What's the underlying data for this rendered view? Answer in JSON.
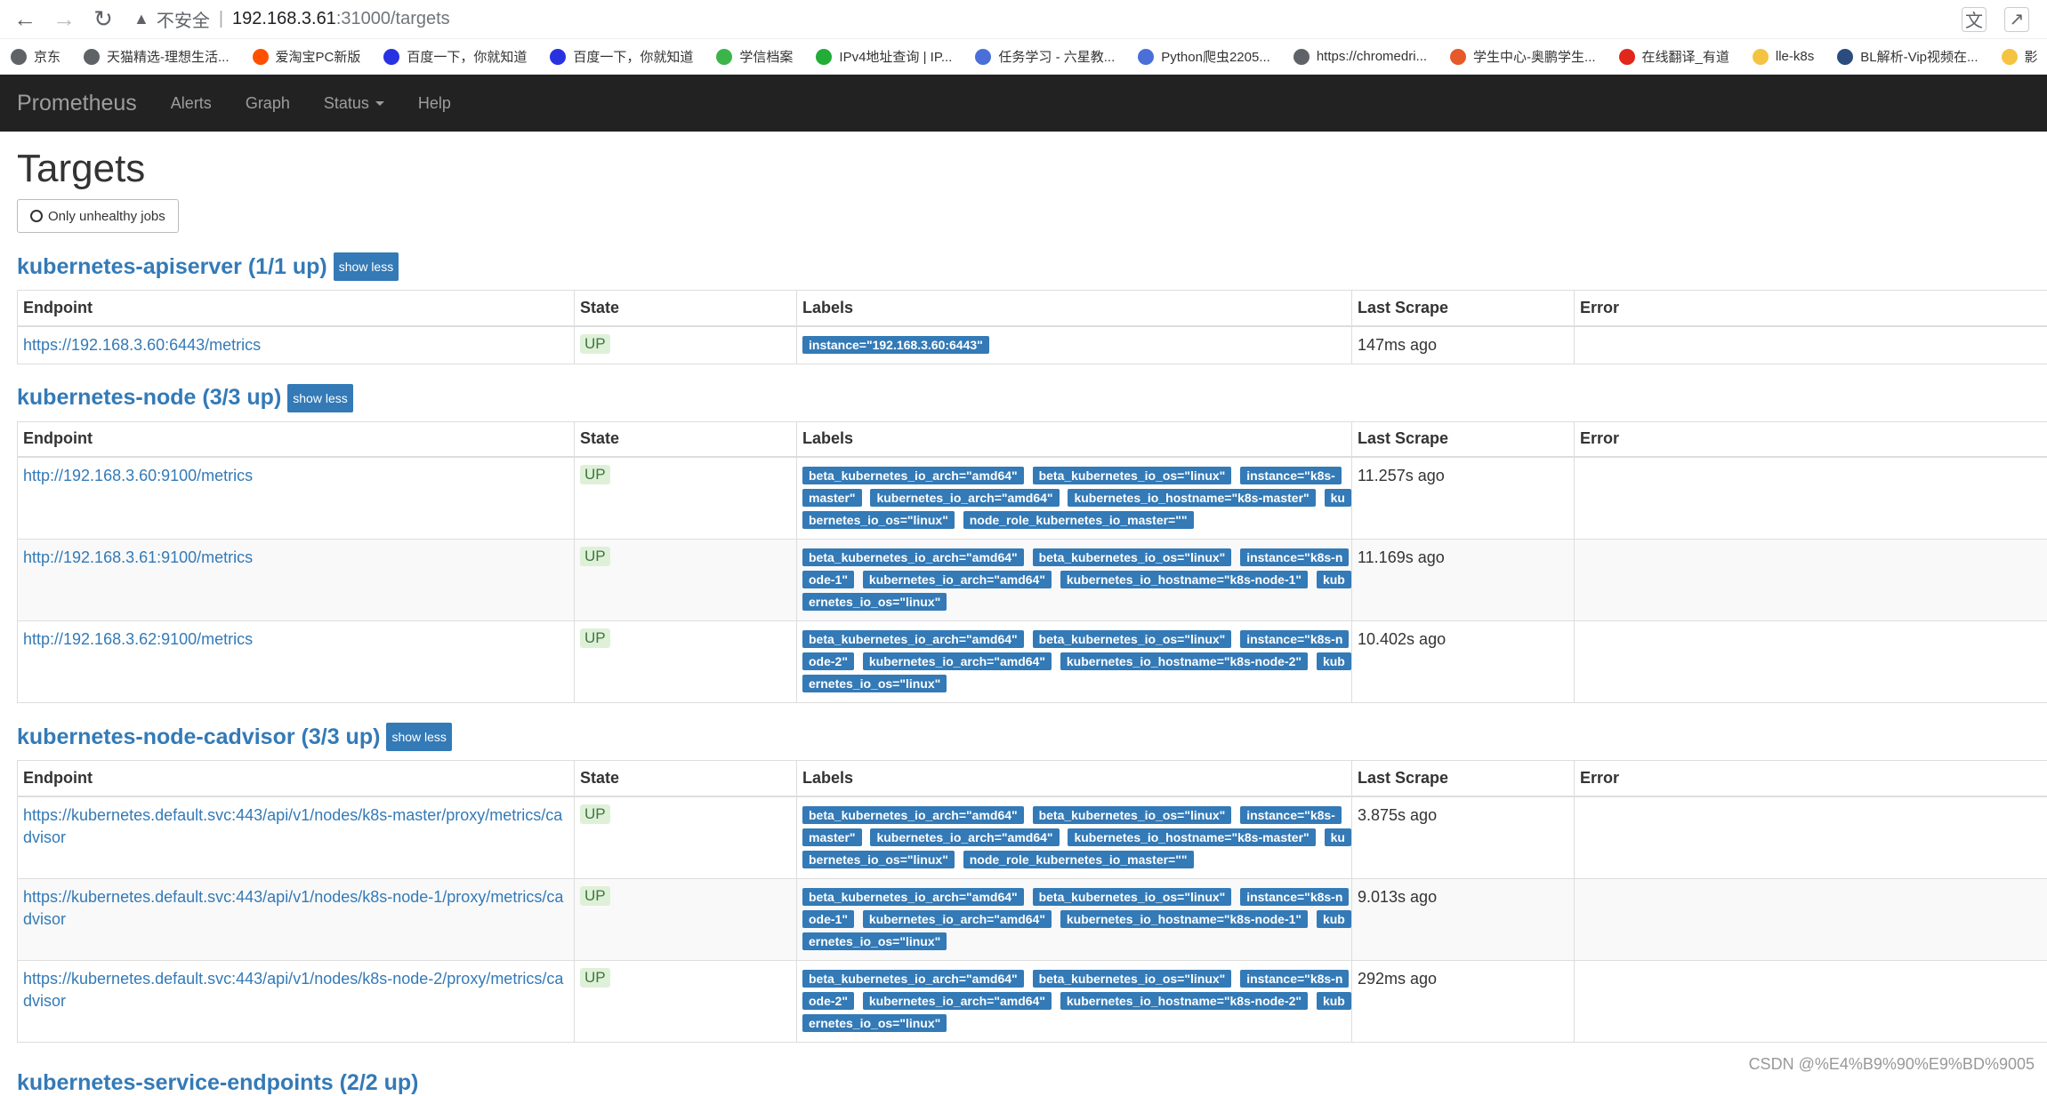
{
  "browser": {
    "insecure_label": "不安全",
    "url_host": "192.168.3.61",
    "url_path": ":31000/targets",
    "bookmarks": [
      {
        "label": "京东",
        "color": "#5f6368"
      },
      {
        "label": "天猫精选-理想生活...",
        "color": "#5f6368"
      },
      {
        "label": "爱淘宝PC新版",
        "color": "#ff5000"
      },
      {
        "label": "百度一下，你就知道",
        "color": "#2932e1"
      },
      {
        "label": "百度一下，你就知道",
        "color": "#2932e1"
      },
      {
        "label": "学信档案",
        "color": "#3bb54a"
      },
      {
        "label": "IPv4地址查询 | IP...",
        "color": "#22ac38"
      },
      {
        "label": "任务学习 - 六星教...",
        "color": "#4a6fd8"
      },
      {
        "label": "Python爬虫2205...",
        "color": "#4a6fd8"
      },
      {
        "label": "https://chromedri...",
        "color": "#5f6368"
      },
      {
        "label": "学生中心-奥鹏学生...",
        "color": "#e65a2a"
      },
      {
        "label": "在线翻译_有道",
        "color": "#e1261c"
      },
      {
        "label": "lle-k8s",
        "color": "#f5c342"
      },
      {
        "label": "BL解析-Vip视频在...",
        "color": "#2b4c7e"
      },
      {
        "label": "影",
        "color": "#f5c342"
      }
    ]
  },
  "navbar": {
    "brand": "Prometheus",
    "links": [
      "Alerts",
      "Graph",
      "Status",
      "Help"
    ]
  },
  "page": {
    "title": "Targets",
    "unhealthy_button": "Only unhealthy jobs",
    "show_less": "show less",
    "columns": [
      "Endpoint",
      "State",
      "Labels",
      "Last Scrape",
      "Error"
    ]
  },
  "jobs": [
    {
      "title": "kubernetes-apiserver (1/1 up)",
      "targets": [
        {
          "endpoint": "https://192.168.3.60:6443/metrics",
          "state": "UP",
          "labels": [
            "instance=\"192.168.3.60:6443\""
          ],
          "last_scrape": "147ms ago",
          "error": ""
        }
      ]
    },
    {
      "title": "kubernetes-node (3/3 up)",
      "targets": [
        {
          "endpoint": "http://192.168.3.60:9100/metrics",
          "state": "UP",
          "labels": [
            "beta_kubernetes_io_arch=\"amd64\"",
            "beta_kubernetes_io_os=\"linux\"",
            "instance=\"k8s-master\"",
            "kubernetes_io_arch=\"amd64\"",
            "kubernetes_io_hostname=\"k8s-master\"",
            "kubernetes_io_os=\"linux\"",
            "node_role_kubernetes_io_master=\"\""
          ],
          "last_scrape": "11.257s ago",
          "error": ""
        },
        {
          "endpoint": "http://192.168.3.61:9100/metrics",
          "state": "UP",
          "labels": [
            "beta_kubernetes_io_arch=\"amd64\"",
            "beta_kubernetes_io_os=\"linux\"",
            "instance=\"k8s-node-1\"",
            "kubernetes_io_arch=\"amd64\"",
            "kubernetes_io_hostname=\"k8s-node-1\"",
            "kubernetes_io_os=\"linux\""
          ],
          "last_scrape": "11.169s ago",
          "error": ""
        },
        {
          "endpoint": "http://192.168.3.62:9100/metrics",
          "state": "UP",
          "labels": [
            "beta_kubernetes_io_arch=\"amd64\"",
            "beta_kubernetes_io_os=\"linux\"",
            "instance=\"k8s-node-2\"",
            "kubernetes_io_arch=\"amd64\"",
            "kubernetes_io_hostname=\"k8s-node-2\"",
            "kubernetes_io_os=\"linux\""
          ],
          "last_scrape": "10.402s ago",
          "error": ""
        }
      ]
    },
    {
      "title": "kubernetes-node-cadvisor (3/3 up)",
      "targets": [
        {
          "endpoint": "https://kubernetes.default.svc:443/api/v1/nodes/k8s-master/proxy/metrics/cadvisor",
          "state": "UP",
          "labels": [
            "beta_kubernetes_io_arch=\"amd64\"",
            "beta_kubernetes_io_os=\"linux\"",
            "instance=\"k8s-master\"",
            "kubernetes_io_arch=\"amd64\"",
            "kubernetes_io_hostname=\"k8s-master\"",
            "kubernetes_io_os=\"linux\"",
            "node_role_kubernetes_io_master=\"\""
          ],
          "last_scrape": "3.875s ago",
          "error": ""
        },
        {
          "endpoint": "https://kubernetes.default.svc:443/api/v1/nodes/k8s-node-1/proxy/metrics/cadvisor",
          "state": "UP",
          "labels": [
            "beta_kubernetes_io_arch=\"amd64\"",
            "beta_kubernetes_io_os=\"linux\"",
            "instance=\"k8s-node-1\"",
            "kubernetes_io_arch=\"amd64\"",
            "kubernetes_io_hostname=\"k8s-node-1\"",
            "kubernetes_io_os=\"linux\""
          ],
          "last_scrape": "9.013s ago",
          "error": ""
        },
        {
          "endpoint": "https://kubernetes.default.svc:443/api/v1/nodes/k8s-node-2/proxy/metrics/cadvisor",
          "state": "UP",
          "labels": [
            "beta_kubernetes_io_arch=\"amd64\"",
            "beta_kubernetes_io_os=\"linux\"",
            "instance=\"k8s-node-2\"",
            "kubernetes_io_arch=\"amd64\"",
            "kubernetes_io_hostname=\"k8s-node-2\"",
            "kubernetes_io_os=\"linux\""
          ],
          "last_scrape": "292ms ago",
          "error": ""
        }
      ]
    }
  ],
  "next_job_partial": "kubernetes-service-endpoints (2/2 up)",
  "watermark": "CSDN @%E4%B9%90%E9%BD%9005",
  "colors": {
    "accent": "#337ab7",
    "up_bg": "#dff0d8",
    "up_text": "#3c763d",
    "navbar": "#222222"
  }
}
